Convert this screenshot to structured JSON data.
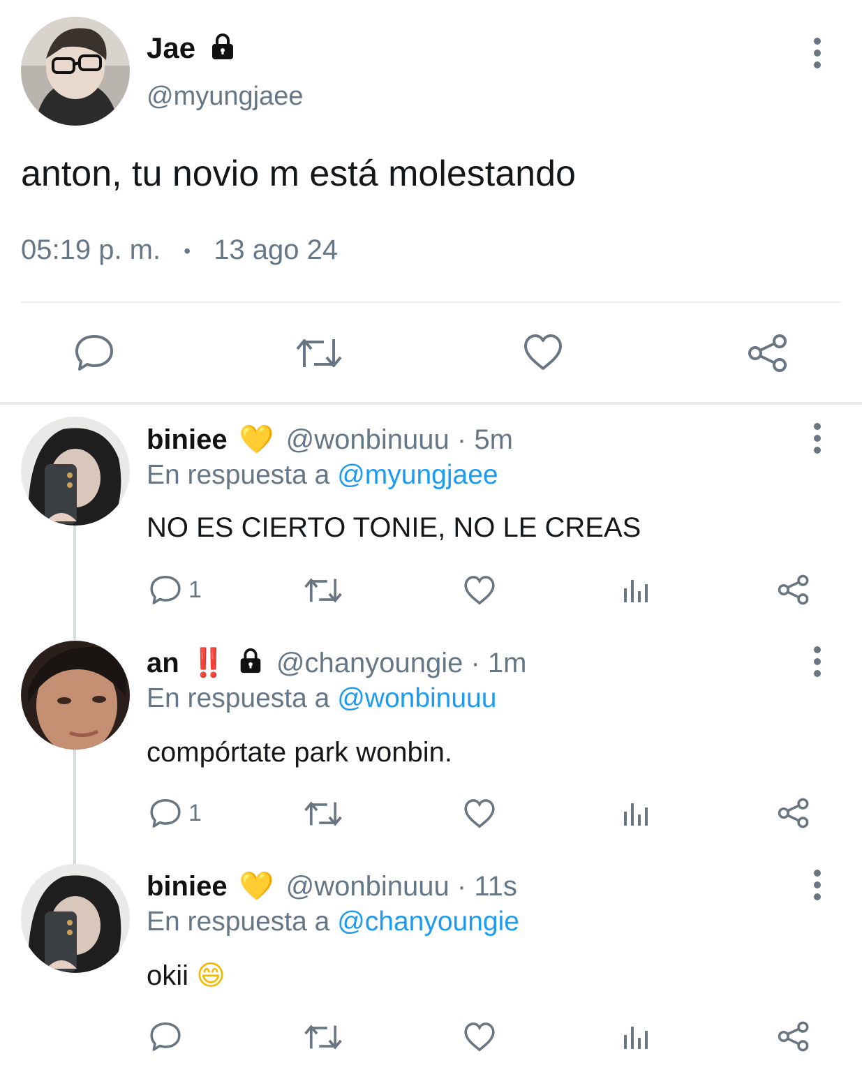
{
  "main_tweet": {
    "name": "Jae",
    "handle": "@myungjaee",
    "text": "anton, tu novio m está molestando",
    "time": "05:19 p. m.",
    "separator": "•",
    "date": "13 ago 24",
    "icons": [
      "lock-icon",
      "more-icon",
      "reply-icon",
      "retweet-icon",
      "like-icon",
      "share-icon"
    ]
  },
  "replies": [
    {
      "name": "biniee",
      "emoji": "💛",
      "handle": "@wonbinuuu",
      "time": "· 5m",
      "reply_prefix": "En respuesta a",
      "reply_to": "@myungjaee",
      "text": "NO ES CIERTO TONIE, NO LE CREAS",
      "reply_count": "1"
    },
    {
      "name": "an",
      "emoji": "‼️",
      "handle": "@chanyoungie",
      "time": "· 1m",
      "reply_prefix": "En respuesta a",
      "reply_to": "@wonbinuuu",
      "text": "compórtate park wonbin.",
      "reply_count": "1"
    },
    {
      "name": "biniee",
      "emoji": "💛",
      "handle": "@wonbinuuu",
      "time": "· 11s",
      "reply_prefix": "En respuesta a",
      "reply_to": "@chanyoungie",
      "text": "okii",
      "text_emoji": "😄",
      "reply_count": ""
    }
  ],
  "colors": {
    "muted": "#657786",
    "link": "#1d9bf0",
    "icon": "#687684",
    "divider": "#e6ecf0"
  }
}
